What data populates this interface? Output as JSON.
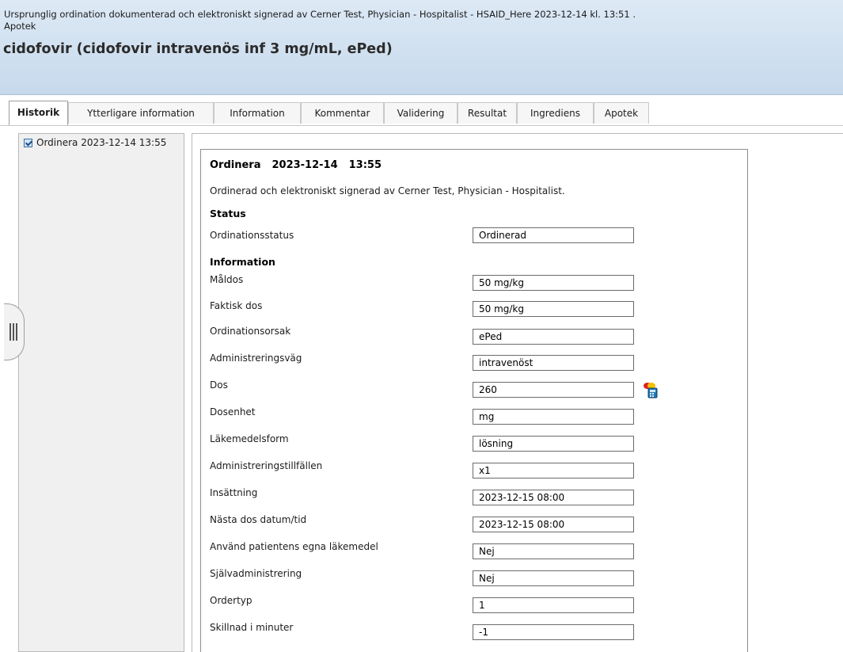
{
  "header": {
    "signed_line": "Ursprunglig ordination dokumenterad och elektroniskt signerad av Cerner Test, Physician - Hospitalist - HSAID_Here 2023-12-14 kl. 13:51 .",
    "category": "Apotek",
    "title": "cidofovir (cidofovir intravenös inf 3 mg/mL, ePed)"
  },
  "tabs": [
    {
      "label": "Historik",
      "active": true
    },
    {
      "label": "Ytterligare information"
    },
    {
      "label": "Information"
    },
    {
      "label": "Kommentar"
    },
    {
      "label": "Validering"
    },
    {
      "label": "Resultat"
    },
    {
      "label": "Ingrediens"
    },
    {
      "label": "Apotek"
    }
  ],
  "history": {
    "items": [
      {
        "label": "Ordinera 2023-12-14 13:55",
        "checked": true
      }
    ]
  },
  "detail": {
    "action": "Ordinera",
    "date": "2023-12-14",
    "time": "13:55",
    "signed_by": "Ordinerad och elektroniskt signerad av Cerner Test, Physician - Hospitalist.",
    "status_heading": "Status",
    "info_heading": "Information",
    "status_rows": [
      {
        "label": "Ordinationsstatus",
        "value": "Ordinerad"
      }
    ],
    "info_rows": [
      {
        "label": "Måldos",
        "value": "50 mg/kg"
      },
      {
        "label": "Faktisk dos",
        "value": "50 mg/kg"
      },
      {
        "label": "Ordinationsorsak",
        "value": "ePed"
      },
      {
        "label": "Administreringsväg",
        "value": "intravenöst"
      },
      {
        "label": "Dos",
        "value": "260"
      },
      {
        "label": "Dosenhet",
        "value": "mg"
      },
      {
        "label": "Läkemedelsform",
        "value": "lösning"
      },
      {
        "label": "Administreringstillfällen",
        "value": "x1"
      },
      {
        "label": "Insättning",
        "value": "2023-12-15 08:00"
      },
      {
        "label": "Nästa dos datum/tid",
        "value": "2023-12-15 08:00"
      },
      {
        "label": "Använd patientens egna läkemedel",
        "value": "Nej"
      },
      {
        "label": "Självadministrering",
        "value": "Nej"
      },
      {
        "label": "Ordertyp",
        "value": "1"
      },
      {
        "label": "Skillnad i minuter",
        "value": "-1"
      }
    ],
    "dose_icon": "medication-calculator-icon"
  }
}
